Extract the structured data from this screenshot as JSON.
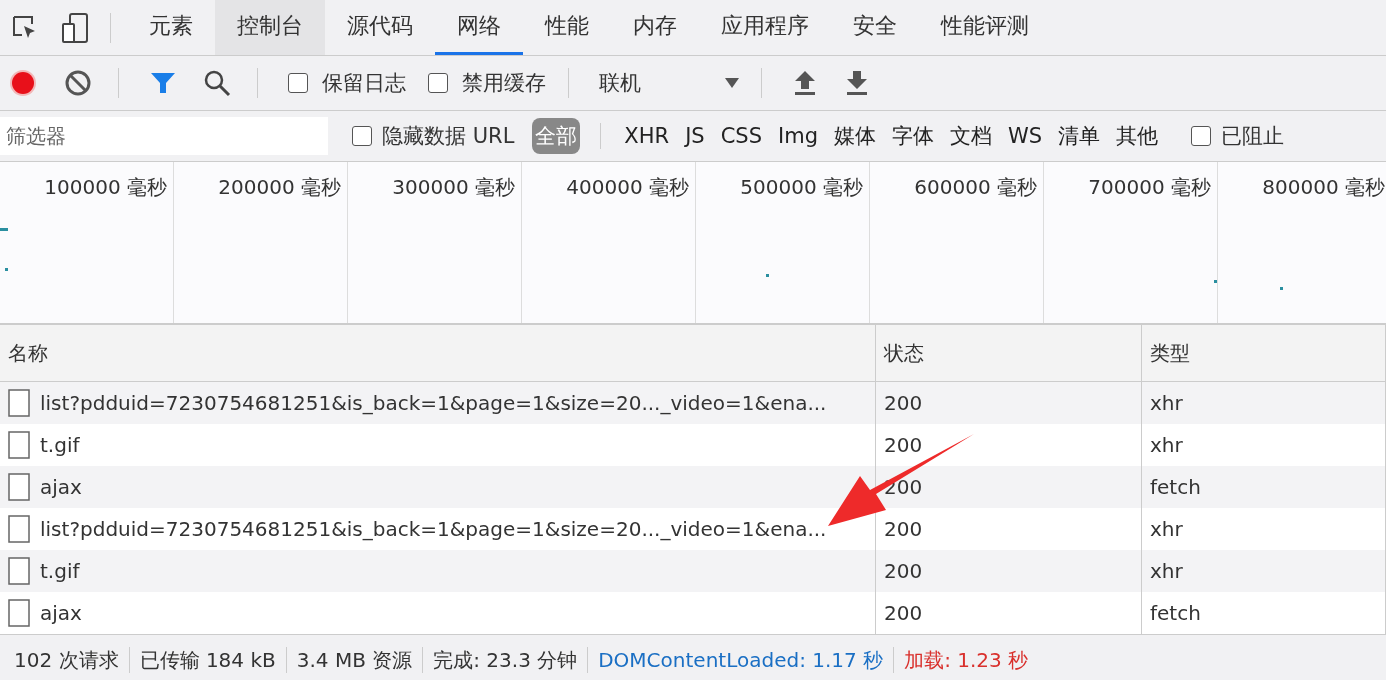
{
  "tabs": [
    {
      "label": "元素",
      "selected": false,
      "hovered": false
    },
    {
      "label": "控制台",
      "selected": false,
      "hovered": true
    },
    {
      "label": "源代码",
      "selected": false,
      "hovered": false
    },
    {
      "label": "网络",
      "selected": true,
      "hovered": false
    },
    {
      "label": "性能",
      "selected": false,
      "hovered": false
    },
    {
      "label": "内存",
      "selected": false,
      "hovered": false
    },
    {
      "label": "应用程序",
      "selected": false,
      "hovered": false
    },
    {
      "label": "安全",
      "selected": false,
      "hovered": false
    },
    {
      "label": "性能评测",
      "selected": false,
      "hovered": false
    }
  ],
  "toolbar": {
    "recording": true,
    "filter_on": true,
    "checkboxes": [
      {
        "label": "保留日志",
        "checked": false
      },
      {
        "label": "禁用缓存",
        "checked": false
      }
    ],
    "throttling": "联机"
  },
  "filter_bar": {
    "placeholder": "筛选器",
    "hide_data_url": {
      "label": "隐藏数据 URL",
      "checked": false
    },
    "types": [
      {
        "label": "全部",
        "selected": true
      },
      {
        "label": "XHR",
        "selected": false
      },
      {
        "label": "JS",
        "selected": false
      },
      {
        "label": "CSS",
        "selected": false
      },
      {
        "label": "Img",
        "selected": false
      },
      {
        "label": "媒体",
        "selected": false
      },
      {
        "label": "字体",
        "selected": false
      },
      {
        "label": "文档",
        "selected": false
      },
      {
        "label": "WS",
        "selected": false
      },
      {
        "label": "清单",
        "selected": false
      },
      {
        "label": "其他",
        "selected": false
      }
    ],
    "blocked": {
      "label": "已阻止",
      "checked": false
    }
  },
  "timeline": {
    "ticks": [
      "100000 毫秒",
      "200000 毫秒",
      "300000 毫秒",
      "400000 毫秒",
      "500000 毫秒",
      "600000 毫秒",
      "700000 毫秒",
      "800000 毫秒"
    ]
  },
  "table": {
    "columns": [
      "名称",
      "状态",
      "类型"
    ],
    "rows": [
      {
        "name": "list?pdduid=7230754681251&is_back=1&page=1&size=20..._video=1&ena...",
        "status": "200",
        "type": "xhr"
      },
      {
        "name": "t.gif",
        "status": "200",
        "type": "xhr"
      },
      {
        "name": "ajax",
        "status": "200",
        "type": "fetch"
      },
      {
        "name": "list?pdduid=7230754681251&is_back=1&page=1&size=20..._video=1&ena...",
        "status": "200",
        "type": "xhr"
      },
      {
        "name": "t.gif",
        "status": "200",
        "type": "xhr"
      },
      {
        "name": "ajax",
        "status": "200",
        "type": "fetch"
      }
    ]
  },
  "status_bar": [
    {
      "text": "102 次请求",
      "kind": "plain"
    },
    {
      "text": "已传输 184 kB",
      "kind": "plain"
    },
    {
      "text": "3.4 MB 资源",
      "kind": "plain"
    },
    {
      "text": "完成: 23.3 分钟",
      "kind": "plain"
    },
    {
      "text": "DOMContentLoaded: 1.17 秒",
      "kind": "dom"
    },
    {
      "text": "加载: 1.23 秒",
      "kind": "load"
    }
  ]
}
